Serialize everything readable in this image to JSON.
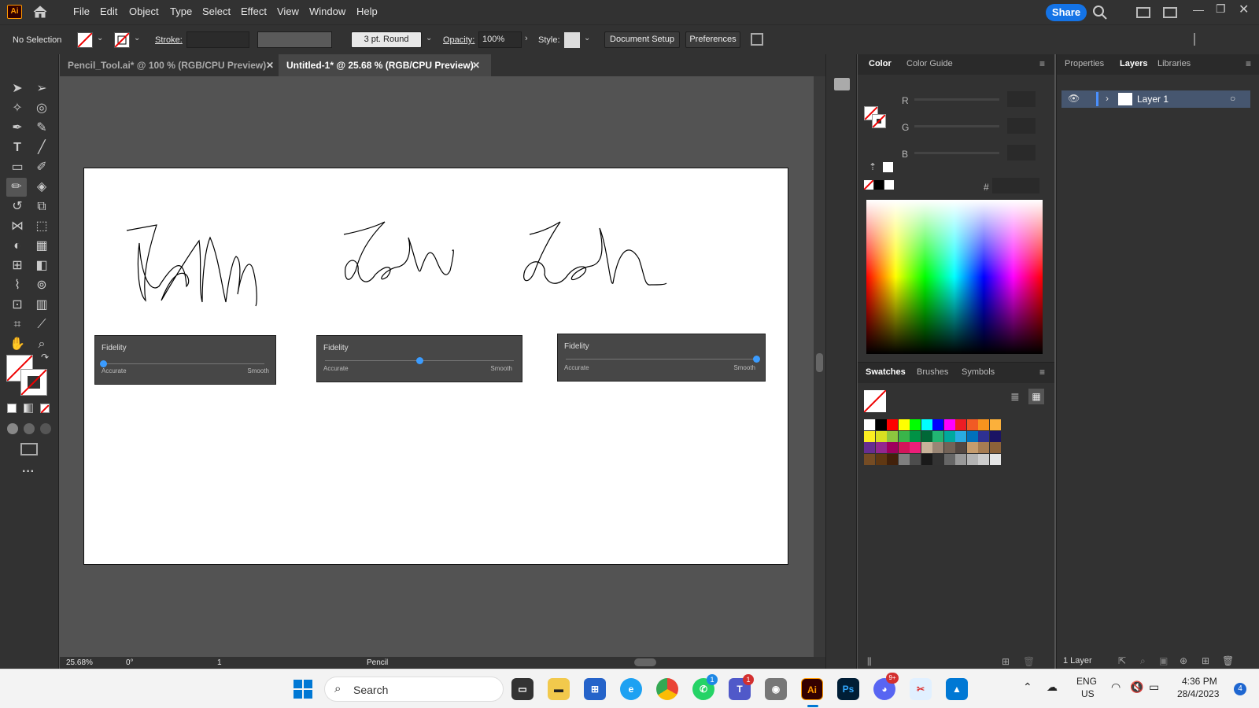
{
  "app": {
    "logo": "Ai"
  },
  "menu": [
    "File",
    "Edit",
    "Object",
    "Type",
    "Select",
    "Effect",
    "View",
    "Window",
    "Help"
  ],
  "share_label": "Share",
  "control_bar": {
    "selection": "No Selection",
    "stroke_label": "Stroke:",
    "brush": "3 pt. Round",
    "opacity_label": "Opacity:",
    "opacity_value": "100%",
    "style_label": "Style:",
    "document_setup": "Document Setup",
    "preferences": "Preferences"
  },
  "tabs": [
    {
      "label": "Pencil_Tool.ai* @ 100 % (RGB/CPU Preview)"
    },
    {
      "label": "Untitled-1* @ 25.68 % (RGB/CPU Preview)"
    }
  ],
  "fidelity_panels": [
    {
      "title": "Fidelity",
      "left": "Accurate",
      "right": "Smooth",
      "value": 0.0
    },
    {
      "title": "Fidelity",
      "left": "Accurate",
      "right": "Smooth",
      "value": 0.5
    },
    {
      "title": "Fidelity",
      "left": "Accurate",
      "right": "Smooth",
      "value": 1.0
    }
  ],
  "status": {
    "zoom": "25.68%",
    "rotation": "0°",
    "artboard": "1",
    "tool": "Pencil"
  },
  "color_panel": {
    "tabs": [
      "Color",
      "Color Guide"
    ],
    "channels": [
      "R",
      "G",
      "B"
    ],
    "hex_label": "#"
  },
  "swatch_panel": {
    "tabs": [
      "Swatches",
      "Brushes",
      "Symbols"
    ]
  },
  "layers_panel": {
    "tabs": [
      "Properties",
      "Layers",
      "Libraries"
    ],
    "layers": [
      {
        "name": "Layer 1"
      }
    ],
    "footer": "1 Layer"
  },
  "taskbar": {
    "search": "Search",
    "lang1": "ENG",
    "lang2": "US",
    "time": "4:36 PM",
    "date": "28/4/2023",
    "notifications": "4",
    "whatsapp_badge": "1",
    "teams_badge": "1",
    "discord_badge": "9+"
  },
  "swatch_rows": [
    [
      "#ffffff",
      "#000000",
      "#ff0000",
      "#ffff00",
      "#00ff00",
      "#00ffff",
      "#0000ff",
      "#ff00ff",
      "#ed1c24",
      "#f15a24",
      "#f7931e",
      "#fbb03b"
    ],
    [
      "#fcee21",
      "#d9e021",
      "#8cc63f",
      "#39b54a",
      "#009245",
      "#006837",
      "#22b573",
      "#00a99d",
      "#29abe2",
      "#0071bc",
      "#2e3192",
      "#1b1464"
    ],
    [
      "#662d91",
      "#93278f",
      "#9e005d",
      "#d4145a",
      "#ed1e79",
      "#c7b299",
      "#998675",
      "#736357",
      "#534741",
      "#c69c6d",
      "#a67c52",
      "#8c6239"
    ],
    [
      "#754c24",
      "#603813",
      "#42210b",
      "#7f7f7f",
      "#4d4d4d",
      "#1a1a1a",
      "#333333",
      "#666666",
      "#999999",
      "#b3b3b3",
      "#cccccc",
      "#e6e6e6"
    ]
  ]
}
